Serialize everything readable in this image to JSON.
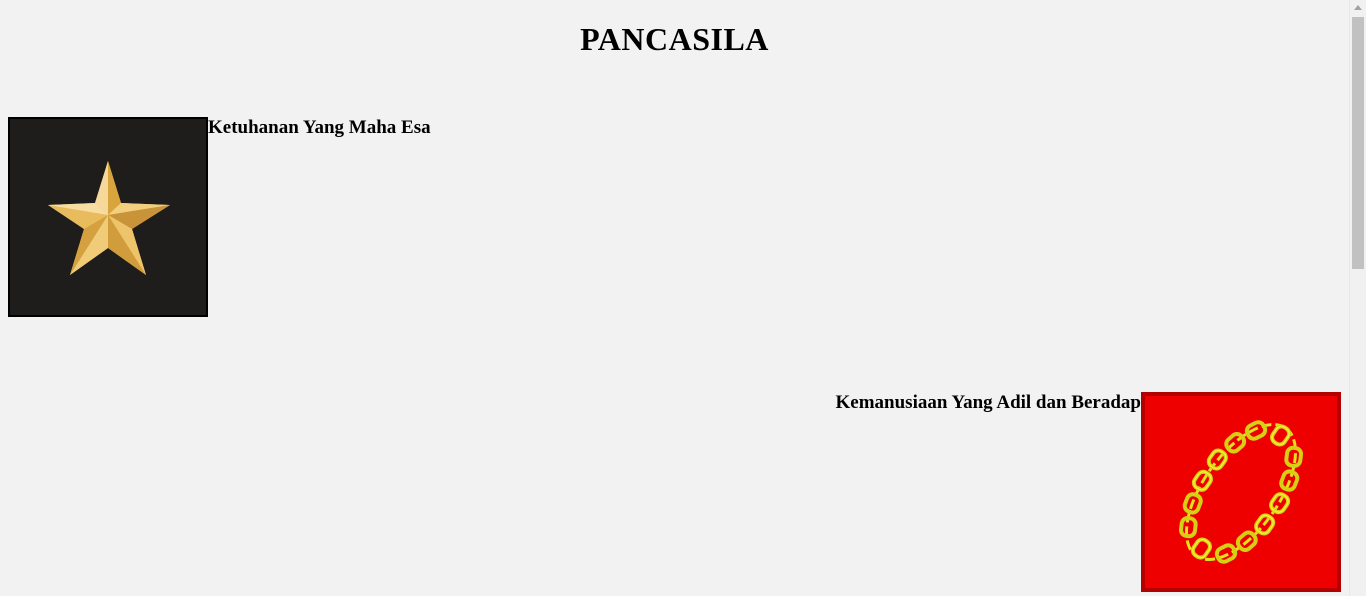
{
  "page": {
    "title": "PANCASILA"
  },
  "sila": [
    {
      "text": "Ketuhanan Yang Maha Esa",
      "icon": "star-icon",
      "background": "#1e1d1b",
      "symbol_color": "#e8bd58"
    },
    {
      "text": "Kemanusiaan Yang Adil dan Beradap",
      "icon": "chain-icon",
      "background": "#ee0000",
      "symbol_color": "#e6e01c"
    }
  ]
}
